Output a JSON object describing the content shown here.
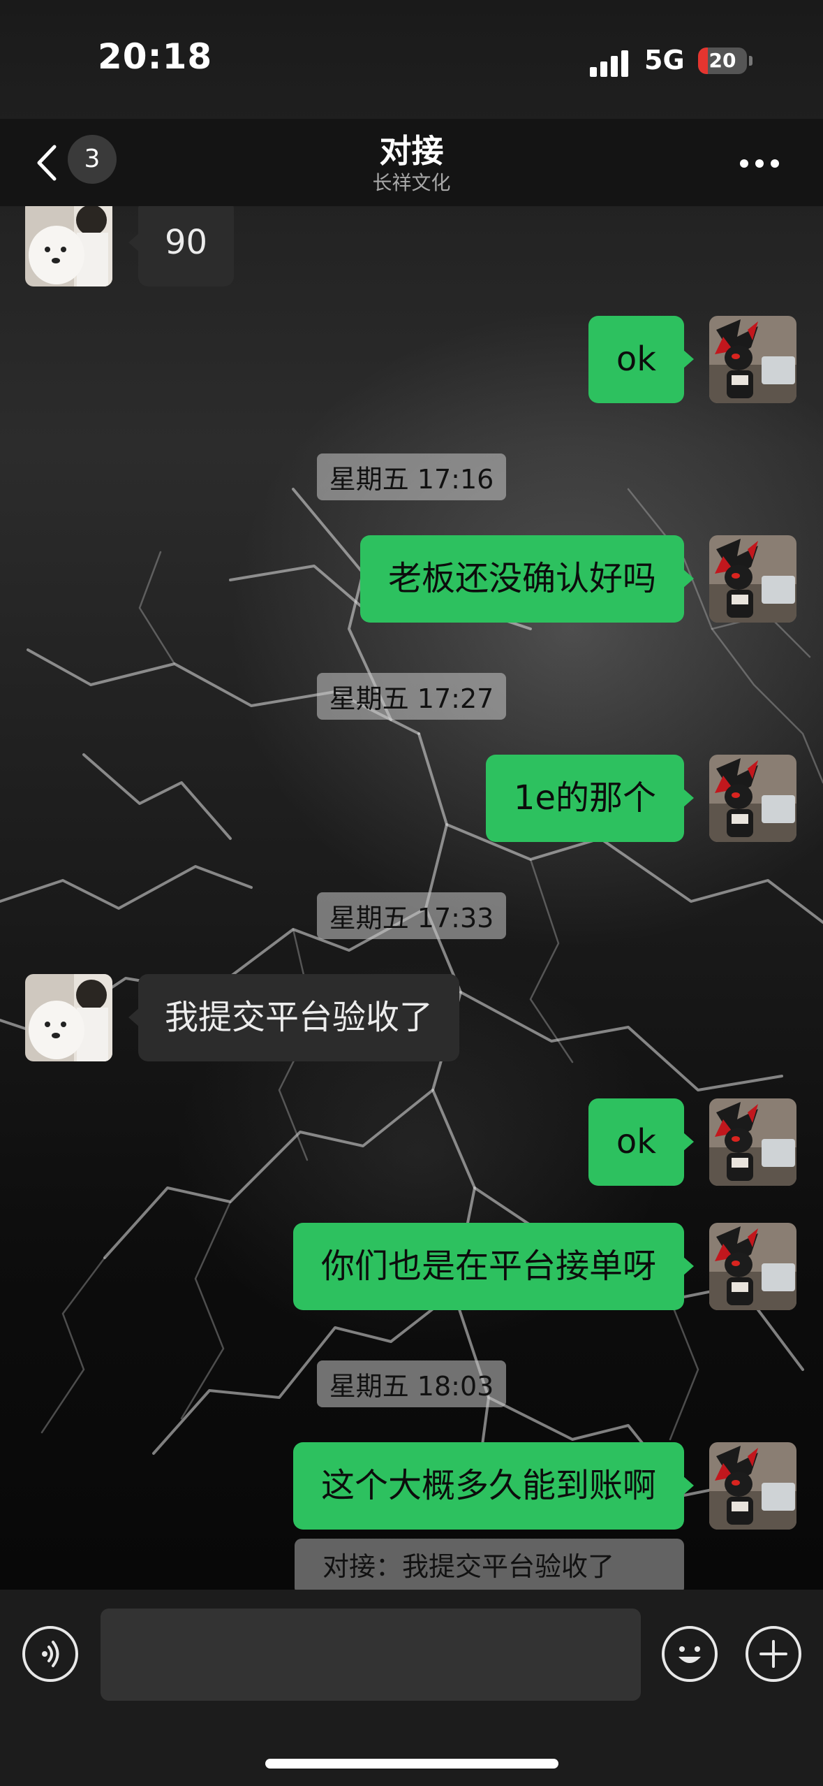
{
  "status_bar": {
    "time": "20:18",
    "network": "5G",
    "battery": "20",
    "battery_level": 0.2
  },
  "nav": {
    "back_icon": "chevron-left-icon",
    "unread_count": "3",
    "title": "对接",
    "subtitle": "长祥文化",
    "more_icon": "more-dots-icon"
  },
  "messages": [
    {
      "type": "in",
      "text": "90"
    },
    {
      "type": "out",
      "text": "ok"
    },
    {
      "type": "time",
      "text": "星期五 17:16"
    },
    {
      "type": "out",
      "text": "老板还没确认好吗"
    },
    {
      "type": "time",
      "text": "星期五 17:27"
    },
    {
      "type": "out",
      "text": "1e的那个"
    },
    {
      "type": "time",
      "text": "星期五 17:33"
    },
    {
      "type": "in",
      "text": "我提交平台验收了"
    },
    {
      "type": "out",
      "text": "ok"
    },
    {
      "type": "out",
      "text": "你们也是在平台接单呀"
    },
    {
      "type": "time",
      "text": "星期五 18:03"
    },
    {
      "type": "out",
      "text": "这个大概多久能到账啊"
    }
  ],
  "quote": {
    "text": "对接：我提交平台验收了"
  },
  "input_bar": {
    "voice_icon": "voice-icon",
    "input_value": "",
    "emoji_icon": "emoji-icon",
    "plus_icon": "plus-icon"
  },
  "colors": {
    "outgoing_bubble": "#2dc15f",
    "incoming_bubble": "#2c2c2c",
    "battery_red": "#e5352f"
  }
}
